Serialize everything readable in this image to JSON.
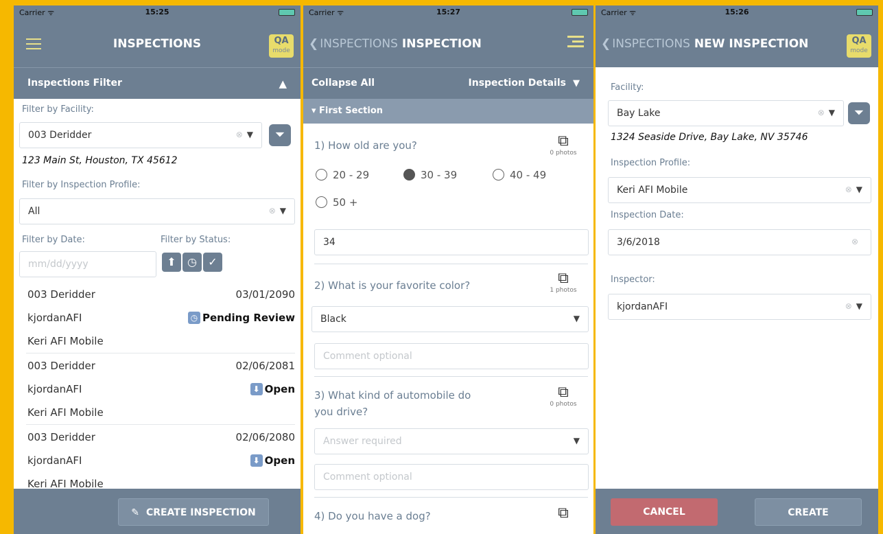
{
  "status": {
    "carrier": "Carrier ᯤ",
    "time1": "15:25",
    "time2": "15:27",
    "time3": "15:26"
  },
  "qa": {
    "big": "QA",
    "small": "mode"
  },
  "screen1": {
    "title": "INSPECTIONS",
    "filter_bar": "Inspections Filter",
    "facility_label": "Filter by Facility:",
    "facility_value": "003 Deridder",
    "facility_address": "123 Main St, Houston, TX 45612",
    "profile_label": "Filter by Inspection Profile:",
    "profile_value": "All",
    "date_label": "Filter by Date:",
    "date_placeholder": "mm/dd/yyyy",
    "status_label": "Filter by Status:",
    "inspections": [
      {
        "facility": "003 Deridder",
        "date": "03/01/2090",
        "inspector": "kjordanAFI",
        "status": "Pending Review",
        "profile": "Keri AFI Mobile"
      },
      {
        "facility": "003 Deridder",
        "date": "02/06/2081",
        "inspector": "kjordanAFI",
        "status": "Open",
        "profile": "Keri AFI Mobile"
      },
      {
        "facility": "003 Deridder",
        "date": "02/06/2080",
        "inspector": "kjordanAFI",
        "status": "Open",
        "profile": "Keri AFI Mobile"
      }
    ],
    "create_button": "CREATE INSPECTION"
  },
  "screen2": {
    "back": "INSPECTIONS",
    "title": "INSPECTION",
    "collapse_all": "Collapse All",
    "details": "Inspection Details",
    "section": "▾ First Section",
    "q1": "1) How old are you?",
    "q1_photos": "0 photos",
    "q1_options": [
      "20 - 29",
      "30 - 39",
      "40 - 49",
      "50 +"
    ],
    "q1_answer": "34",
    "q2": "2) What is your favorite color?",
    "q2_photos": "1 photos",
    "q2_value": "Black",
    "comment_placeholder": "Comment optional",
    "q3_line1": "3) What kind of automobile do",
    "q3_line2": "you drive?",
    "q3_photos": "0 photos",
    "q3_placeholder": "Answer required",
    "q4": "4) Do you have a dog?"
  },
  "screen3": {
    "back": "INSPECTIONS",
    "title": "NEW INSPECTION",
    "facility_label": "Facility:",
    "facility_value": "Bay Lake",
    "facility_address": "1324 Seaside Drive, Bay Lake, NV 35746",
    "profile_label": "Inspection Profile:",
    "profile_value": "Keri AFI Mobile",
    "date_label": "Inspection Date:",
    "date_value": "3/6/2018",
    "inspector_label": "Inspector:",
    "inspector_value": "kjordanAFI",
    "cancel": "CANCEL",
    "create": "CREATE"
  }
}
